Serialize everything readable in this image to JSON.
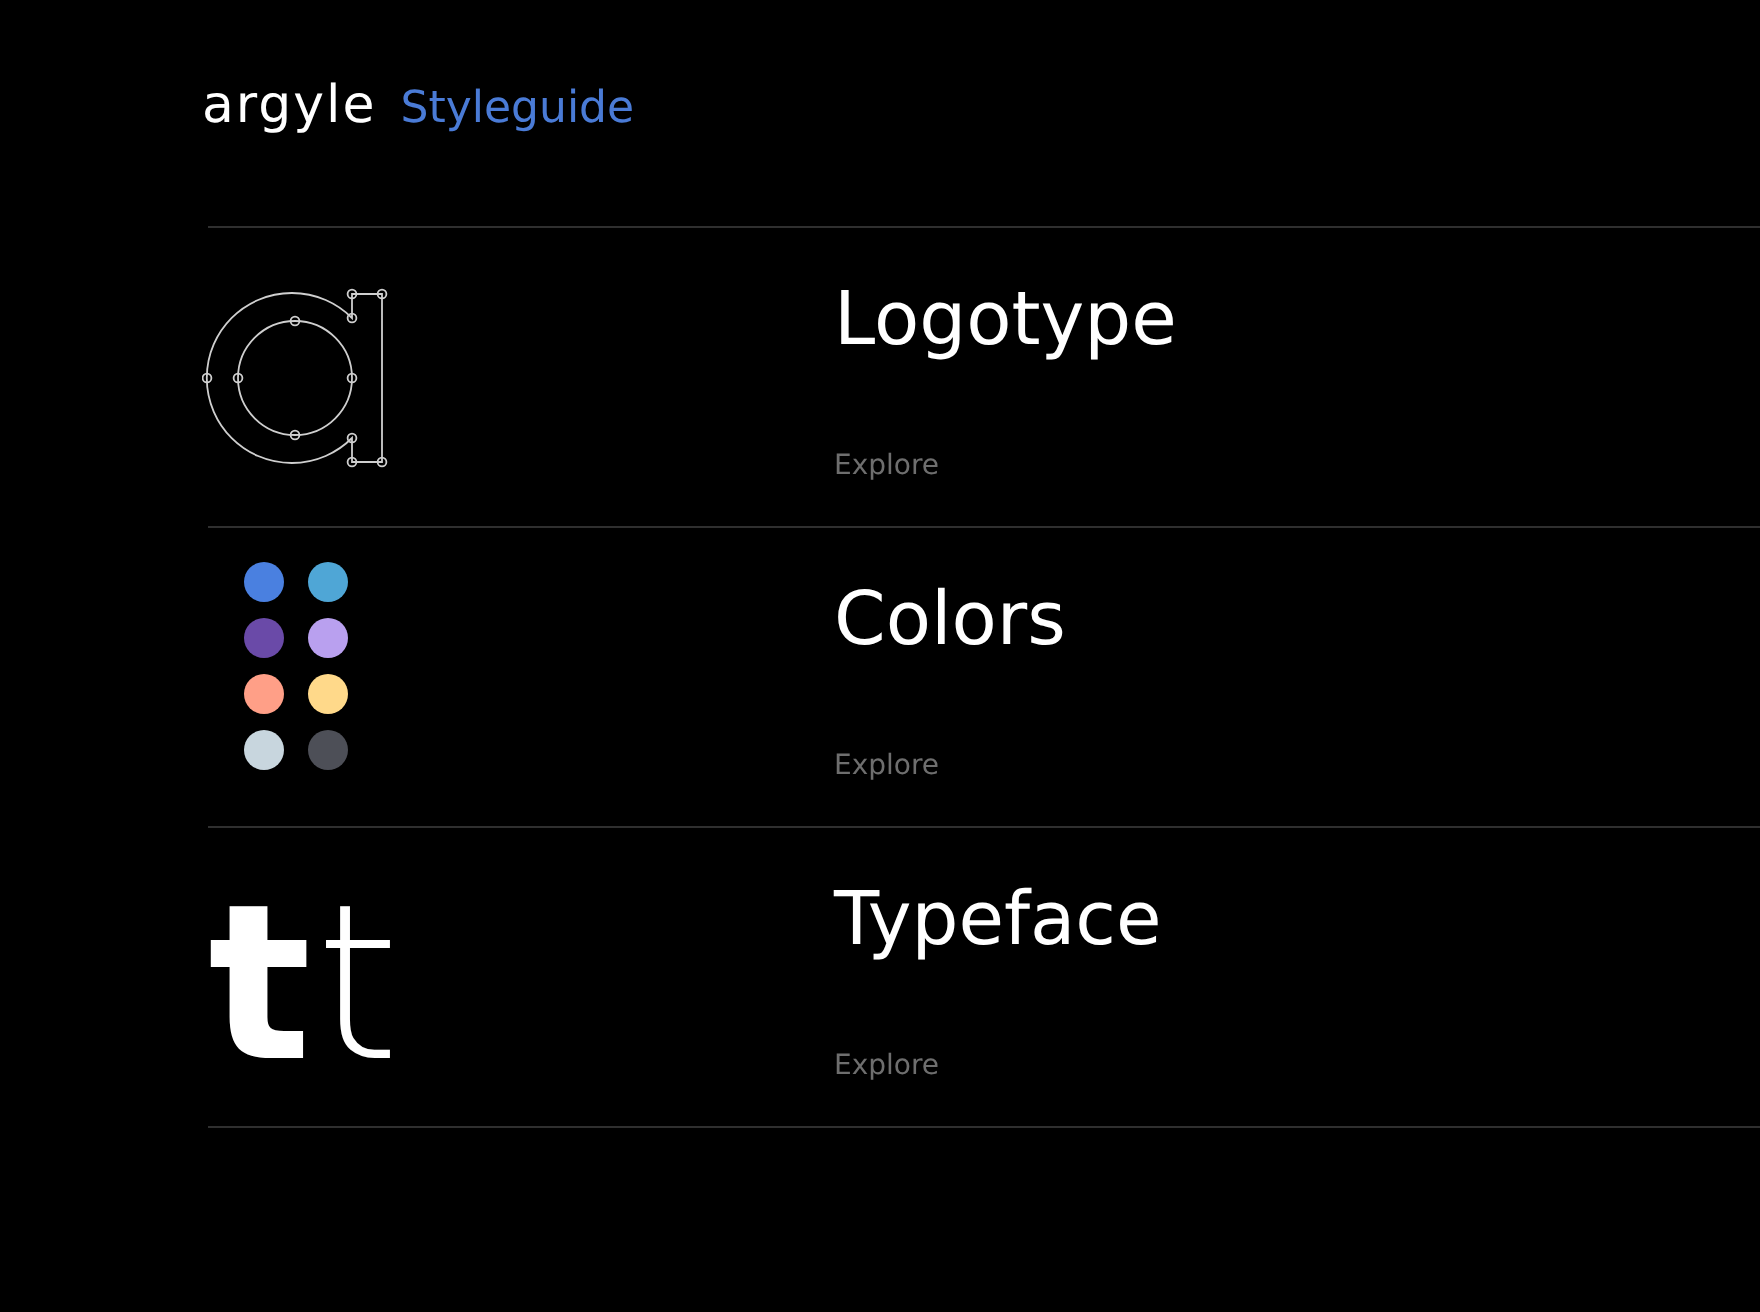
{
  "header": {
    "logo": "argyle",
    "title": "Styleguide"
  },
  "sections": [
    {
      "kind": "logotype",
      "title": "Logotype",
      "link": "Explore"
    },
    {
      "kind": "colors",
      "title": "Colors",
      "link": "Explore",
      "swatches": [
        {
          "color": "#4a80e0"
        },
        {
          "color": "#4fa6d6"
        },
        {
          "color": "#6a4aa8"
        },
        {
          "color": "#b9a0ef"
        },
        {
          "color": "#ff9f87"
        },
        {
          "color": "#ffd98a"
        },
        {
          "color": "#c8d6de"
        },
        {
          "color": "#4d4f57"
        }
      ]
    },
    {
      "kind": "typeface",
      "title": "Typeface",
      "link": "Explore",
      "specimen": [
        {
          "glyph": "t",
          "kind": "heavy"
        },
        {
          "glyph": "t",
          "kind": "light"
        }
      ]
    }
  ]
}
